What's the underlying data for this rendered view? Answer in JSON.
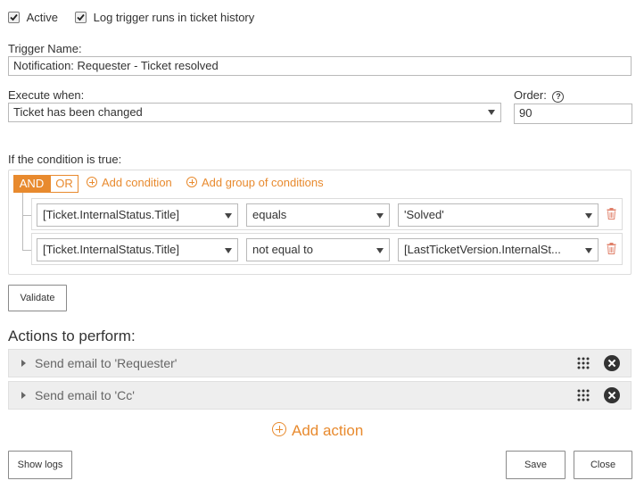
{
  "top_options": {
    "active_label": "Active",
    "active_checked": true,
    "log_label": "Log trigger runs in ticket history",
    "log_checked": true
  },
  "trigger_name": {
    "label": "Trigger Name:",
    "value": "Notification: Requester - Ticket resolved"
  },
  "execute_when": {
    "label": "Execute when:",
    "value": "Ticket has been changed"
  },
  "order": {
    "label": "Order:",
    "help_icon": "question-circle-icon",
    "value": "90"
  },
  "conditions": {
    "label": "If the condition is true:",
    "and_label": "AND",
    "or_label": "OR",
    "selected_operator": "AND",
    "add_condition_label": "Add condition",
    "add_group_label": "Add group of conditions",
    "rows": [
      {
        "field": "[Ticket.InternalStatus.Title]",
        "operator": "equals",
        "value": "'Solved'"
      },
      {
        "field": "[Ticket.InternalStatus.Title]",
        "operator": "not equal to",
        "value": "[LastTicketVersion.InternalSt..."
      }
    ]
  },
  "validate_label": "Validate",
  "actions": {
    "title": "Actions to perform:",
    "items": [
      {
        "label": "Send email to 'Requester'"
      },
      {
        "label": "Send email to 'Cc'"
      }
    ],
    "add_action_label": "Add action"
  },
  "footer": {
    "show_logs_label": "Show logs",
    "save_label": "Save",
    "close_label": "Close"
  },
  "colors": {
    "accent": "#e88a2e",
    "text": "#333333",
    "action_row_bg": "#eeeeee",
    "delete_icon": "#e0806a"
  }
}
